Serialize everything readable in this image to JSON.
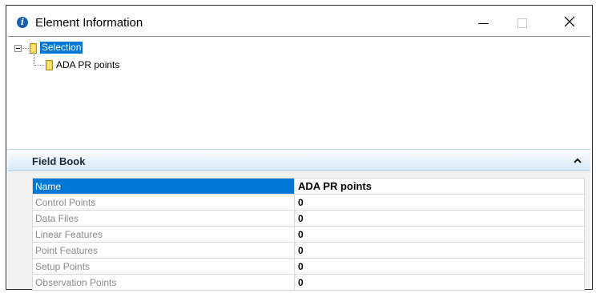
{
  "window": {
    "title": "Element Information",
    "icon": "info-icon",
    "controls": [
      "minimize-icon",
      "maximize-icon",
      "close-icon"
    ]
  },
  "tree": {
    "root": {
      "label": "Selection",
      "icon": "folder-icon",
      "expanded": true,
      "selected": true
    },
    "children": [
      {
        "label": "ADA PR points",
        "icon": "folder-icon"
      }
    ]
  },
  "section": {
    "title": "Field Book",
    "toggle_icon": "chevron-up-icon"
  },
  "properties": [
    {
      "name": "Name",
      "value": "ADA PR points"
    },
    {
      "name": "Control Points",
      "value": "0"
    },
    {
      "name": "Data Files",
      "value": "0"
    },
    {
      "name": "Linear Features",
      "value": "0"
    },
    {
      "name": "Point Features",
      "value": "0"
    },
    {
      "name": "Setup Points",
      "value": "0"
    },
    {
      "name": "Observation Points",
      "value": "0"
    }
  ],
  "colors": {
    "selection": "#0078d7",
    "info_icon": "#1a5fb4",
    "folder": "#f2d04a"
  }
}
